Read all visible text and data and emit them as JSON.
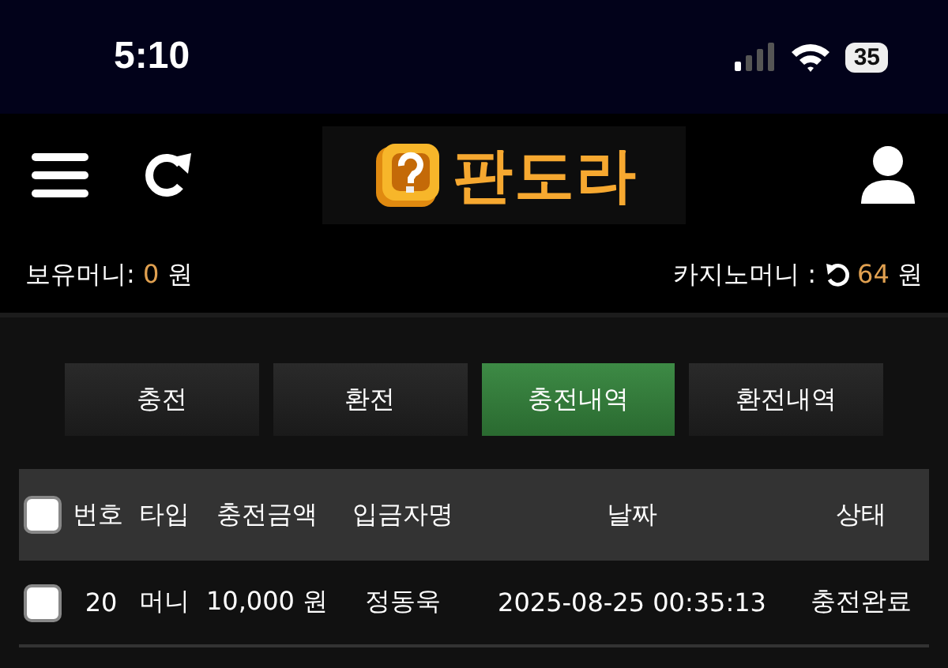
{
  "status_bar": {
    "time": "5:10",
    "battery": "35"
  },
  "header": {
    "logo_text": "판도라"
  },
  "balances": {
    "holding_label": "보유머니:",
    "holding_value": "0",
    "holding_unit": "원",
    "casino_label": "카지노머니 :",
    "casino_value": "64",
    "casino_unit": "원"
  },
  "tabs": [
    {
      "label": "충전",
      "selected": false
    },
    {
      "label": "환전",
      "selected": false
    },
    {
      "label": "충전내역",
      "selected": true
    },
    {
      "label": "환전내역",
      "selected": false
    }
  ],
  "table": {
    "select_all_checked": false,
    "columns": [
      "번호",
      "타입",
      "충전금액",
      "입금자명",
      "날짜",
      "상태"
    ],
    "rows": [
      {
        "checked": false,
        "cells": [
          "20",
          "머니",
          "10,000 원",
          "정동욱",
          "2025-08-25 00:35:13",
          "충전완료"
        ]
      }
    ]
  }
}
